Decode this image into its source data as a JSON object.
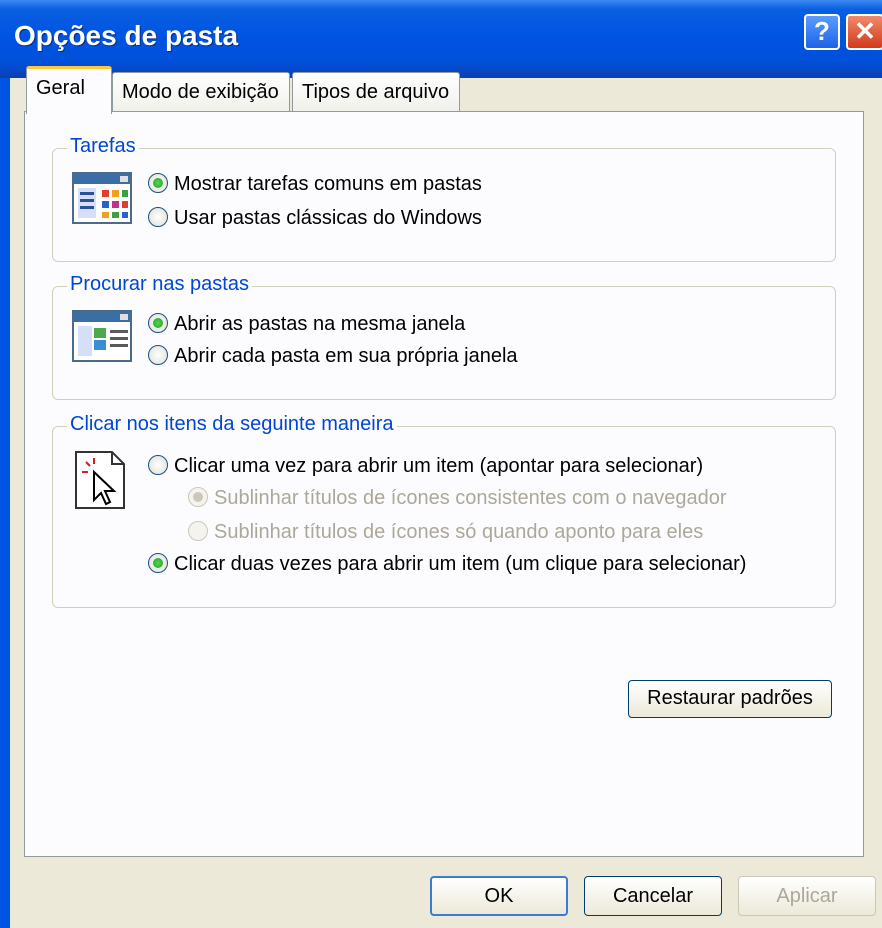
{
  "window": {
    "title": "Opções de pasta",
    "help_button": "?",
    "close_button": "✕"
  },
  "tabs": [
    {
      "label": "Geral",
      "active": true
    },
    {
      "label": "Modo de exibição",
      "active": false
    },
    {
      "label": "Tipos de arquivo",
      "active": false
    }
  ],
  "groups": {
    "tarefas": {
      "title": "Tarefas",
      "options": [
        "Mostrar tarefas comuns em pastas",
        "Usar pastas clássicas do Windows"
      ]
    },
    "procurar": {
      "title": "Procurar nas pastas",
      "options": [
        "Abrir as pastas na mesma janela",
        "Abrir cada pasta em sua própria janela"
      ]
    },
    "clicar": {
      "title": "Clicar nos itens da seguinte maneira",
      "options": [
        "Clicar uma vez para abrir um item (apontar para selecionar)",
        "Sublinhar títulos de ícones consistentes com o navegador",
        "Sublinhar títulos de ícones só quando aponto para eles",
        "Clicar duas vezes para abrir um item (um clique para selecionar)"
      ]
    }
  },
  "buttons": {
    "restore": "Restaurar padrões",
    "ok": "OK",
    "cancel": "Cancelar",
    "apply": "Aplicar"
  },
  "colors": {
    "titlebar": "#0054e3",
    "accent_label": "#0046d5",
    "face": "#ece9d8"
  }
}
